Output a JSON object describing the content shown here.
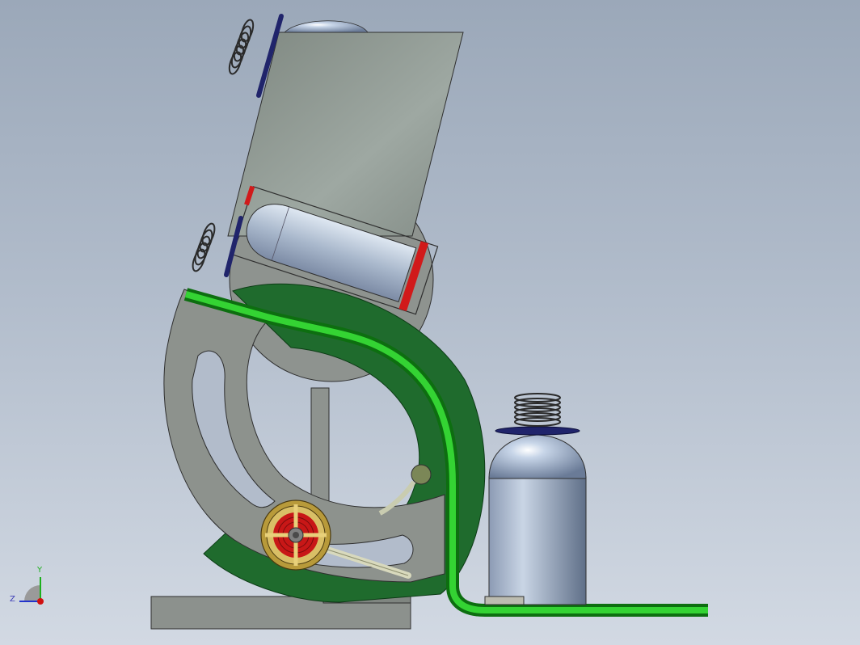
{
  "view": {
    "background_top": "#9ba8b9",
    "background_bottom": "#d2d9e3"
  },
  "colors": {
    "frame_gray": "#8d928d",
    "plate_gray": "#9aa39d",
    "part_green": "#1f6b2d",
    "tube_green": "#20b321",
    "bottle_light": "#c6d2e2",
    "bottle_dark": "#6f7f99",
    "thread_dark": "#3a3a3a",
    "flange_navy": "#20246b",
    "accent_red": "#d11a1a",
    "wheel_gold": "#b08f2e"
  },
  "triad": {
    "y_label": "Y",
    "z_label": "Z"
  }
}
